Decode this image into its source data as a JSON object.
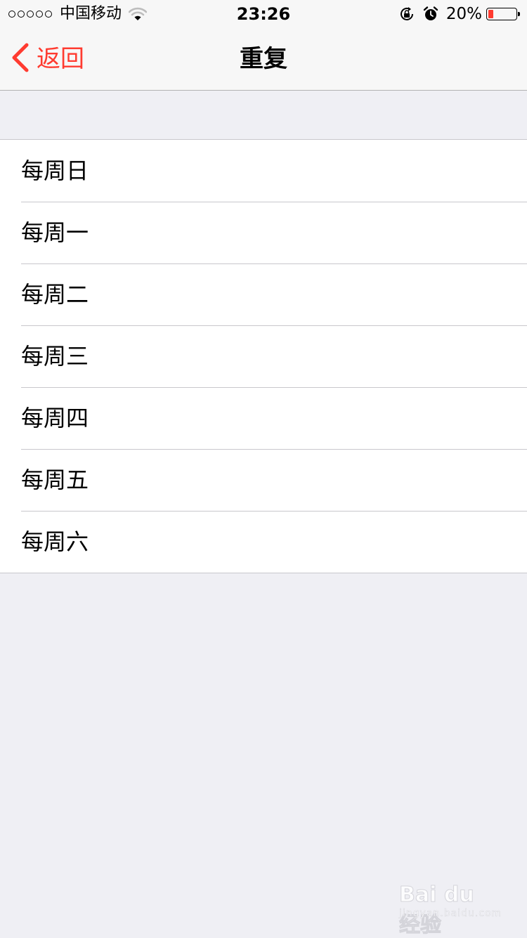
{
  "status_bar": {
    "signal_dots": 5,
    "carrier": "中国移动",
    "time": "23:26",
    "battery_percent": "20%",
    "battery_level": 0.2,
    "battery_color": "#ff3b30",
    "icons": [
      "wifi-icon",
      "orientation-lock-icon",
      "alarm-icon",
      "battery-icon"
    ]
  },
  "nav": {
    "back_label": "返回",
    "title": "重复",
    "accent_color": "#ff3b30"
  },
  "list": {
    "items": [
      {
        "label": "每周日"
      },
      {
        "label": "每周一"
      },
      {
        "label": "每周二"
      },
      {
        "label": "每周三"
      },
      {
        "label": "每周四"
      },
      {
        "label": "每周五"
      },
      {
        "label": "每周六"
      }
    ]
  },
  "watermark": {
    "brand": "Bai du 经验",
    "url": "jingyan.baidu.com"
  }
}
